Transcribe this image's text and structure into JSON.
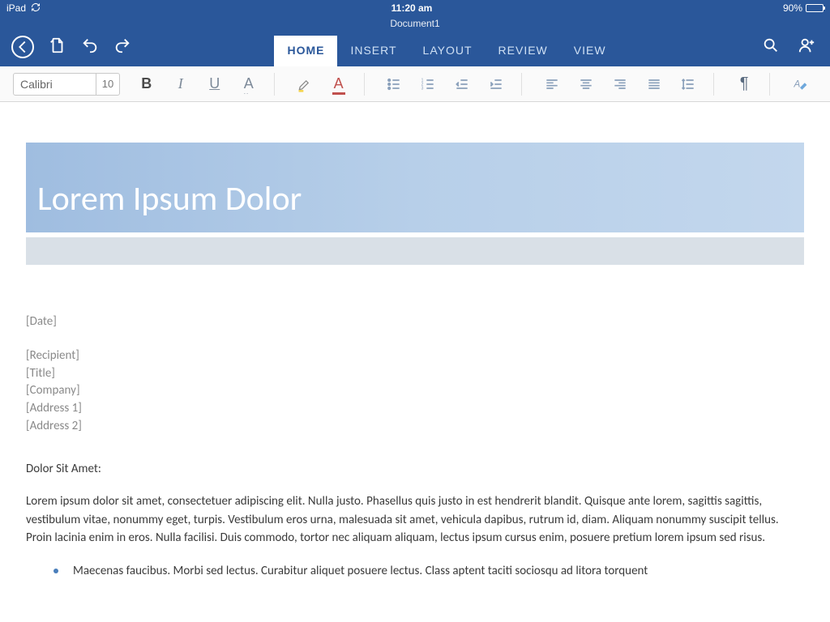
{
  "status": {
    "device": "iPad",
    "time": "11:20 am",
    "battery_pct": "90%"
  },
  "doc": {
    "title": "Document1"
  },
  "tabs": [
    "HOME",
    "INSERT",
    "LAYOUT",
    "REVIEW",
    "VIEW"
  ],
  "active_tab": "HOME",
  "ribbon": {
    "font_name": "Calibri",
    "font_size": "10"
  },
  "content": {
    "heading": "Lorem Ipsum Dolor",
    "placeholders_top": [
      "[Date]"
    ],
    "placeholders_block": [
      "[Recipient]",
      "[Title]",
      "[Company]",
      "[Address 1]",
      "[Address 2]"
    ],
    "salutation": "Dolor Sit Amet:",
    "paragraph": "Lorem ipsum dolor sit amet, consectetuer adipiscing elit. Nulla justo. Phasellus quis justo in est hendrerit blandit. Quisque ante lorem, sagittis sagittis, vestibulum vitae, nonummy eget, turpis. Vestibulum eros urna, malesuada sit amet, vehicula dapibus, rutrum id, diam. Aliquam nonummy suscipit tellus. Proin lacinia enim in eros. Nulla facilisi. Duis commodo, tortor nec aliquam aliquam, lectus ipsum cursus enim, posuere pretium lorem ipsum sed risus.",
    "bullet": "Maecenas faucibus. Morbi sed lectus. Curabitur aliquet posuere lectus. Class aptent taciti sociosqu ad litora torquent"
  }
}
